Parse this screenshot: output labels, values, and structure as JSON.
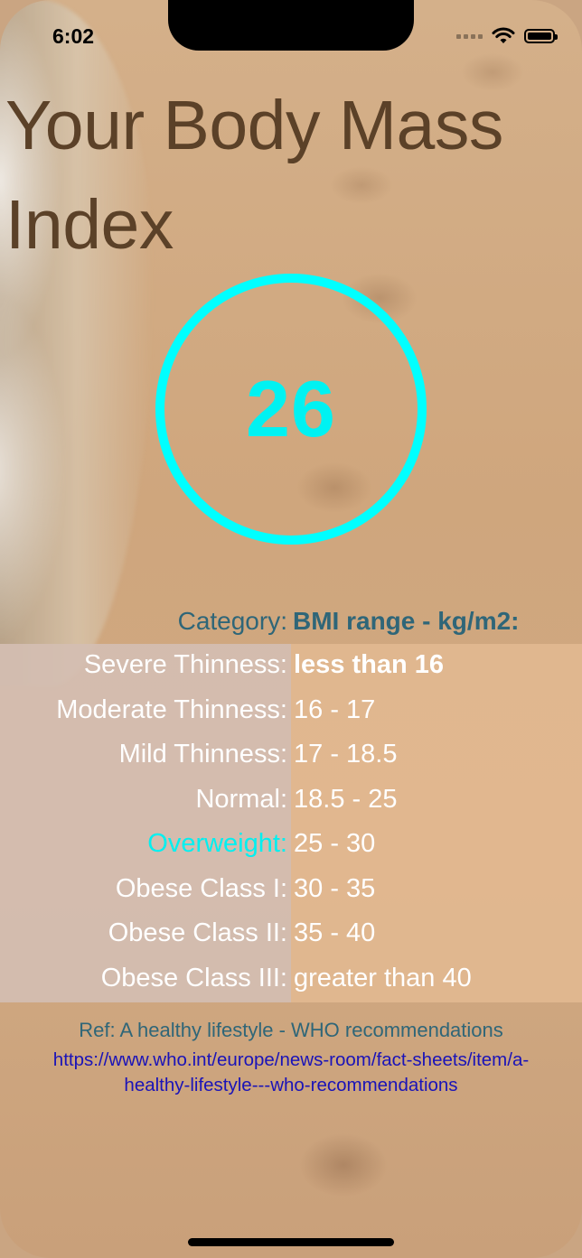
{
  "status_bar": {
    "time": "6:02"
  },
  "title": "Your Body Mass Index",
  "bmi": {
    "value": "26",
    "ring_color": "#00ffff"
  },
  "table": {
    "header_category": "Category:",
    "header_range": "BMI range - kg/m2:",
    "rows": [
      {
        "category": "Severe Thinness:",
        "range": "less than 16"
      },
      {
        "category": "Moderate Thinness:",
        "range": "16 - 17"
      },
      {
        "category": "Mild Thinness:",
        "range": "17 - 18.5"
      },
      {
        "category": "Normal:",
        "range": "18.5 - 25"
      },
      {
        "category": "Overweight:",
        "range": "25 - 30"
      },
      {
        "category": "Obese Class I:",
        "range": "30 - 35"
      },
      {
        "category": "Obese Class II:",
        "range": "35 - 40"
      },
      {
        "category": "Obese Class III:",
        "range": "greater than 40"
      }
    ],
    "highlight_color": "#00f0f0"
  },
  "reference": {
    "text": "Ref: A healthy lifestyle - WHO recommendations",
    "link_line1": "https://www.who.int/europe/news-room/fact-sheets/item/a-",
    "link_line2": "healthy-lifestyle---who-recommendations"
  }
}
